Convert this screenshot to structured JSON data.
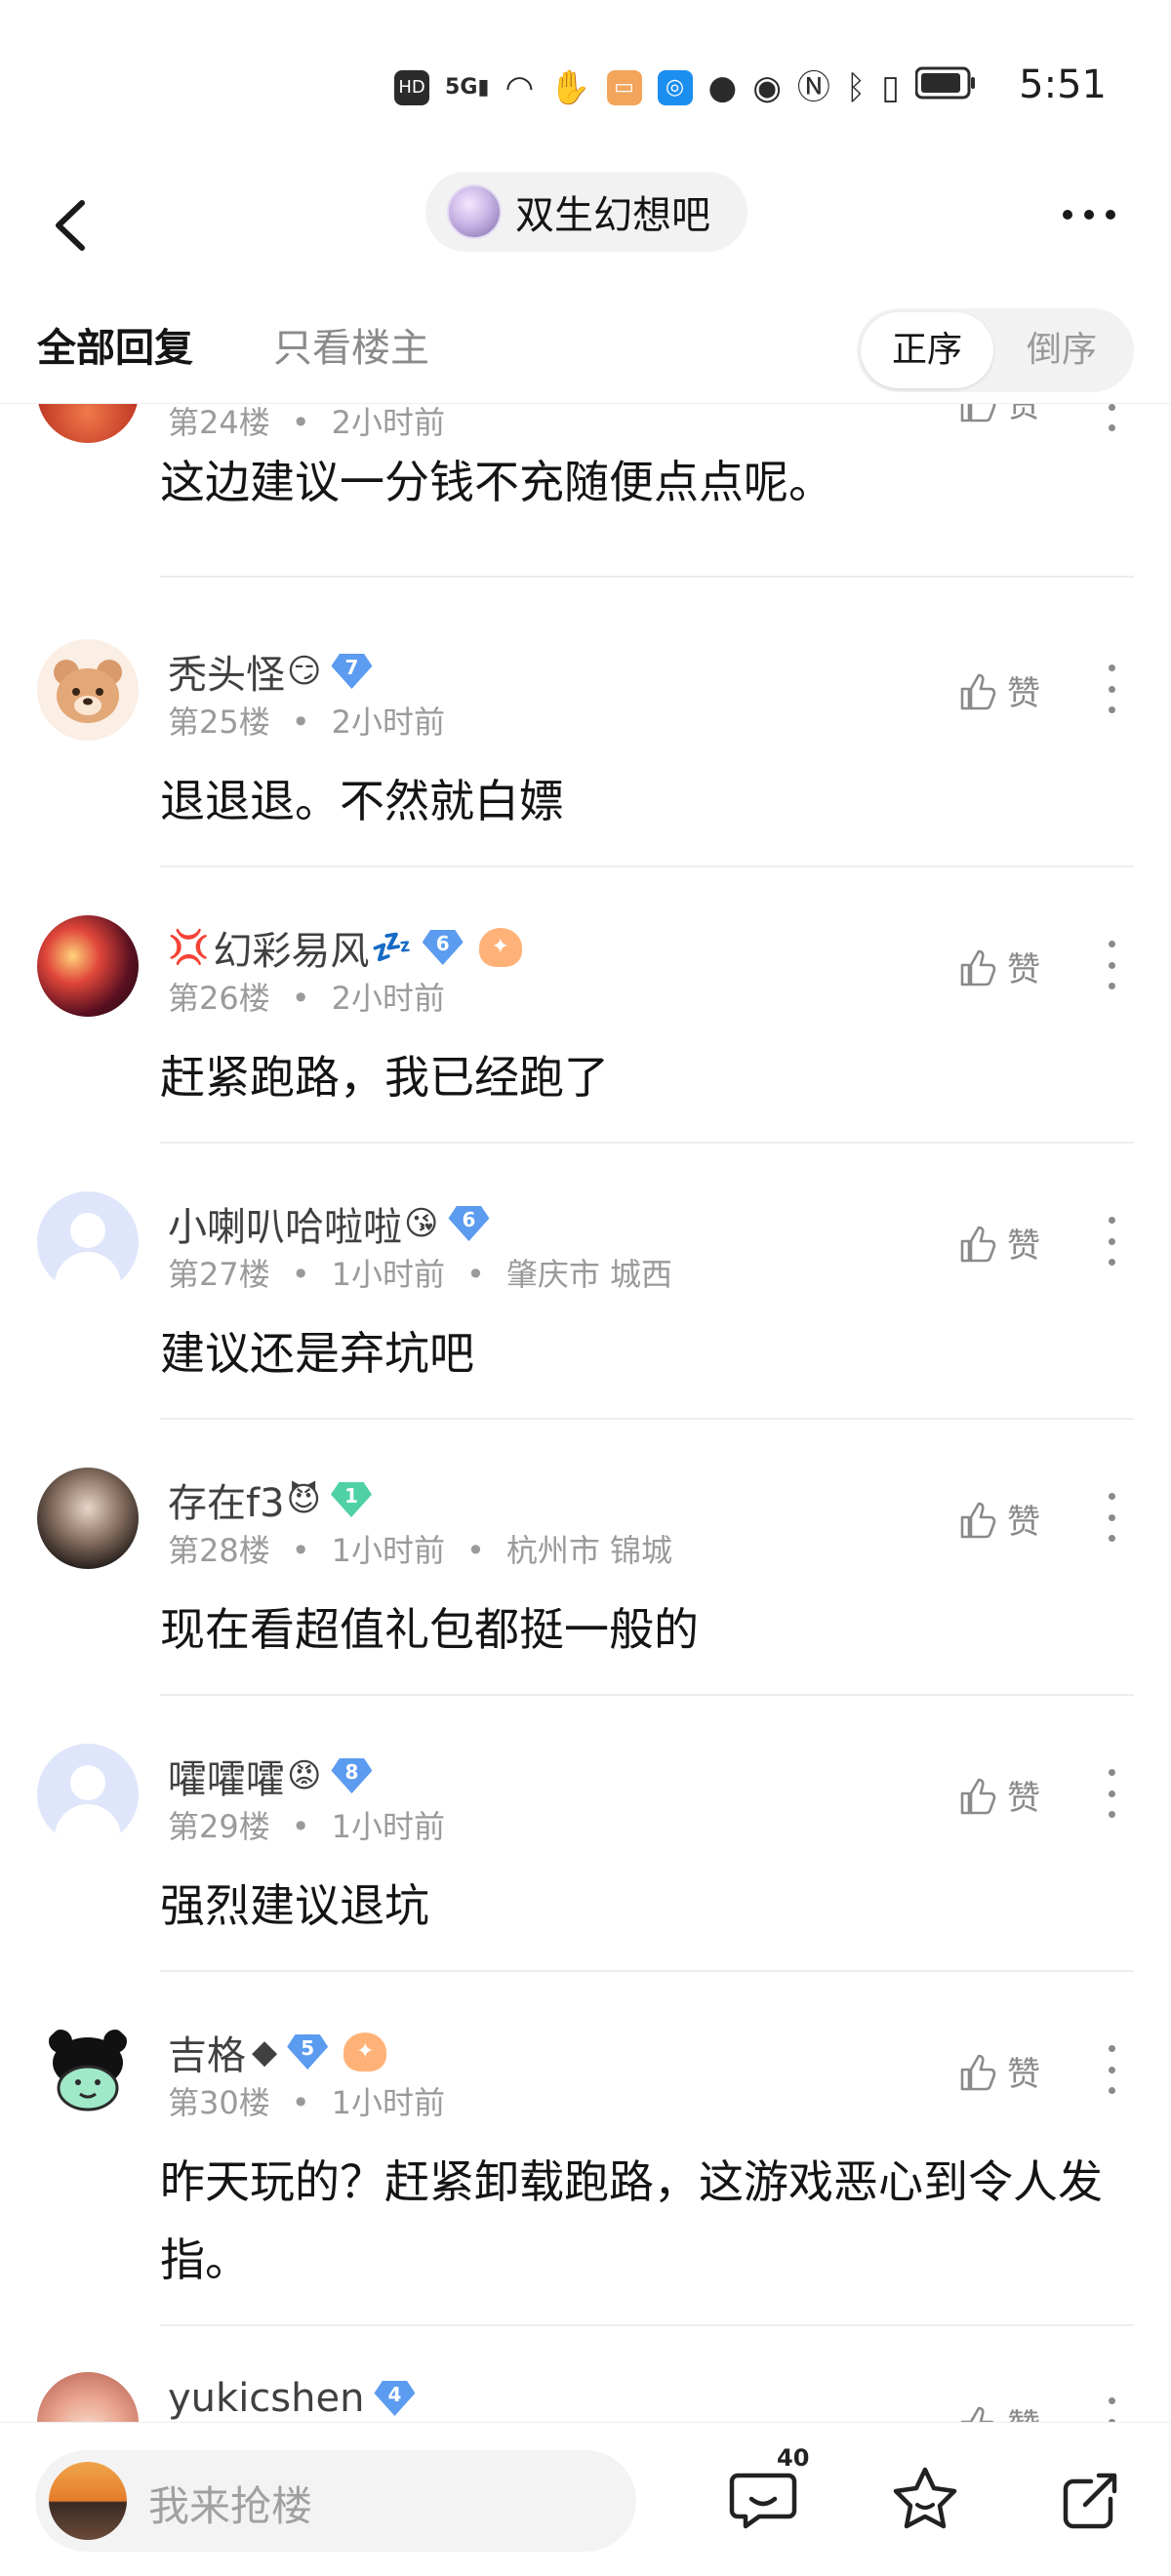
{
  "status_bar": {
    "time": "5:51",
    "icons": [
      "hd-icon",
      "signal-5g-icon",
      "wifi-icon",
      "hand-icon",
      "message-app-icon",
      "browser-app-icon",
      "chat-bubble-icon",
      "eye-icon",
      "nfc-icon",
      "bluetooth-icon",
      "vibrate-icon",
      "battery-icon"
    ],
    "hd_label": "HD",
    "net_label": "5G"
  },
  "nav": {
    "forum_name": "双生幻想吧"
  },
  "tabs": {
    "all_replies": "全部回复",
    "owner_only": "只看楼主",
    "sort_asc": "正序",
    "sort_desc": "倒序"
  },
  "posts": [
    {
      "user": "",
      "floor": "第24楼",
      "time": "2小时前",
      "like": "赞",
      "content": "这边建议一分钱不充随便点点呢。"
    },
    {
      "user": "秃头怪",
      "emoji": "😏",
      "level": "7",
      "floor": "第25楼",
      "time": "2小时前",
      "like": "赞",
      "content": "退退退。不然就白嫖"
    },
    {
      "user": "幻彩易风",
      "emoji_before": "💢",
      "emoji": "💤",
      "level": "6",
      "floor": "第26楼",
      "time": "2小时前",
      "like": "赞",
      "content": "赶紧跑路，我已经跑了"
    },
    {
      "user": "小喇叭哈啦啦",
      "emoji": "😘",
      "level": "6",
      "floor": "第27楼",
      "time": "1小时前",
      "location": "肇庆市 城西",
      "like": "赞",
      "content": "建议还是弃坑吧"
    },
    {
      "user": "存在f3",
      "emoji": "😈",
      "level": "1",
      "floor": "第28楼",
      "time": "1小时前",
      "location": "杭州市 锦城",
      "like": "赞",
      "content": "现在看超值礼包都挺一般的"
    },
    {
      "user": "嚯嚯嚯",
      "emoji": "😡",
      "level": "8",
      "floor": "第29楼",
      "time": "1小时前",
      "like": "赞",
      "content": "强烈建议退坑"
    },
    {
      "user": "吉格",
      "emoji": "◆",
      "level": "5",
      "floor": "第30楼",
      "time": "1小时前",
      "like": "赞",
      "content": "昨天玩的？赶紧卸载跑路，这游戏恶心到令人发指。"
    },
    {
      "user": "yukicshen",
      "level": "4",
      "like": "赞"
    }
  ],
  "bottom": {
    "input_placeholder": "我来抢楼",
    "reply_count": "40"
  }
}
